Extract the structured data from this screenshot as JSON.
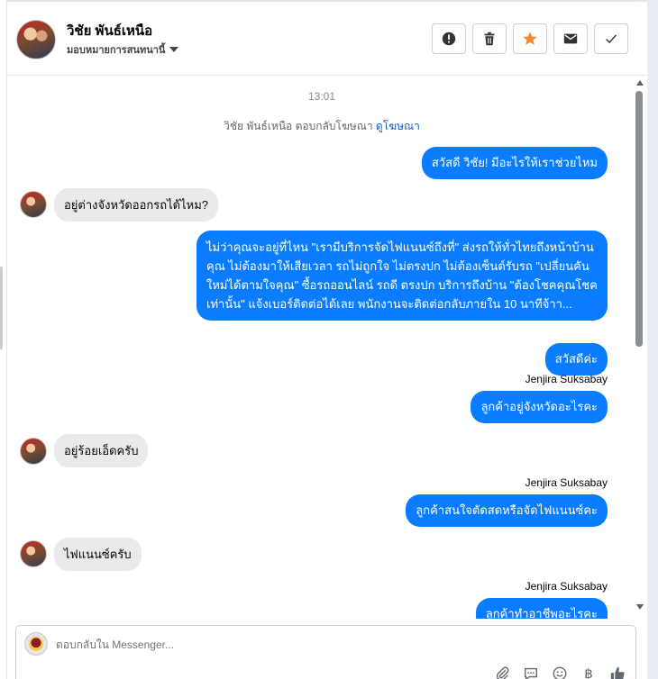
{
  "header": {
    "contact_name": "วิชัย พันธ์เหนือ",
    "assign_label": "มอบหมายการสนทนานี้",
    "actions": [
      {
        "icon": "alert-icon",
        "name": "spam-button"
      },
      {
        "icon": "trash-icon",
        "name": "delete-button"
      },
      {
        "icon": "star-icon",
        "name": "star-button"
      },
      {
        "icon": "envelope-icon",
        "name": "mark-unread-button"
      },
      {
        "icon": "check-icon",
        "name": "mark-done-button"
      }
    ]
  },
  "conversation": {
    "timestamp": "13:01",
    "system_text": "วิชัย พันธ์เหนือ ตอบกลับโฆษณา",
    "system_link": "ดูโฆษณา",
    "messages": [
      {
        "dir": "out",
        "text": "สวัสดี วิชัย! มีอะไรให้เราช่วยไหม"
      },
      {
        "dir": "in",
        "text": "อยู่ต่างจังหวัดออกรถได้ไหม?"
      },
      {
        "dir": "out",
        "text": "ไม่ว่าคุณจะอยู่ที่ไหน \"เรามีบริการจัดไฟแนนซ์ถึงที่\"  ส่งรถให้ทั่วไทยถึงหน้าบ้านคุณ ไม่ต้องมาให้เสียเวลา รถไม่ถูกใจ ไม่ตรงปก ไม่ต้องเซ็นต์รับรถ \"เปลี่ยนคันใหม่ได้ตามใจคุณ\" ซื้อรถออนไลน์ รถดี ตรงปก บริการถึงบ้าน \"ต้องโชคคุณโชคเท่านั้น\" แจ้งเบอร์ติดต่อได้เลย พนักงานจะติดต่อกลับภายใน 10 นาทีจ้าา..."
      },
      {
        "dir": "out",
        "text": "สวัสดีค่ะ"
      },
      {
        "dir": "sender",
        "text": "Jenjira Suksabay"
      },
      {
        "dir": "out",
        "text": "ลูกค้าอยู่จังหวัดอะไรคะ"
      },
      {
        "dir": "in",
        "text": "อยู่ร้อยเอ็ดครับ"
      },
      {
        "dir": "sender",
        "text": "Jenjira Suksabay"
      },
      {
        "dir": "out",
        "text": "ลูกค้าสนใจตัดสดหรือจัดไฟแนนซ์คะ"
      },
      {
        "dir": "in",
        "text": "ไฟแนนซ์ครับ"
      },
      {
        "dir": "sender",
        "text": "Jenjira Suksabay"
      },
      {
        "dir": "out",
        "text": "ลูกค้าทำอาชีพอะไรคะ"
      }
    ]
  },
  "composer": {
    "placeholder": "ตอบกลับใน Messenger...",
    "tools": [
      "attach-icon",
      "saved-reply-icon",
      "emoji-icon",
      "payment-icon",
      "like-icon"
    ],
    "payment_glyph": "฿"
  },
  "colors": {
    "outgoing_bubble": "#0a7cff",
    "incoming_bubble": "#e9eaec",
    "star_accent": "#f2892a",
    "link": "#1a5cc8"
  }
}
